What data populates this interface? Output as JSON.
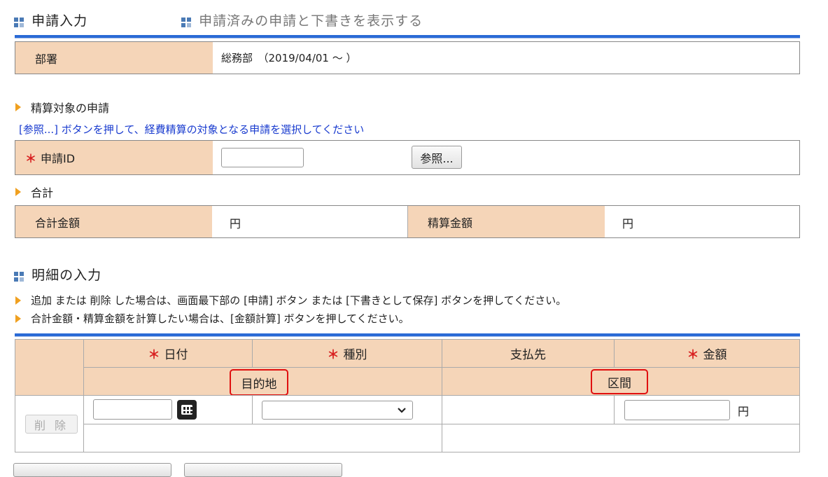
{
  "tabs": {
    "input": "申請入力",
    "list": "申請済みの申請と下書きを表示する"
  },
  "department": {
    "label": "部署",
    "value": "総務部　（2019/04/01 ～ ）"
  },
  "target": {
    "heading": "精算対象の申請",
    "hint": "[参照...] ボタンを押して、経費精算の対象となる申請を選択してください",
    "id_label": "申請ID",
    "id_value": "",
    "browse_button": "参照..."
  },
  "total": {
    "heading": "合計",
    "total_label": "合計金額",
    "total_value": "円",
    "settle_label": "精算金額",
    "settle_value": "円"
  },
  "detail": {
    "heading": "明細の入力",
    "note1": "追加 または 削除 した場合は、画面最下部の [申請] ボタン または [下書きとして保存] ボタンを押してください。",
    "note2": "合計金額・精算金額を計算したい場合は、[金額計算] ボタンを押してください。",
    "required_mark": "＊",
    "columns": {
      "date": "日付",
      "type": "種別",
      "payee": "支払先",
      "amount": "金額",
      "destination": "目的地",
      "section": "区間"
    },
    "row": {
      "delete_button": "削 除",
      "date_value": "",
      "type_value": "",
      "amount_value": "",
      "yen": "円"
    }
  },
  "colors": {
    "accent": "#2a6ad6",
    "label_bg": "#f5d5b8",
    "hint_text": "#1a3ccf",
    "required": "#d82020",
    "highlight": "#e01010"
  }
}
